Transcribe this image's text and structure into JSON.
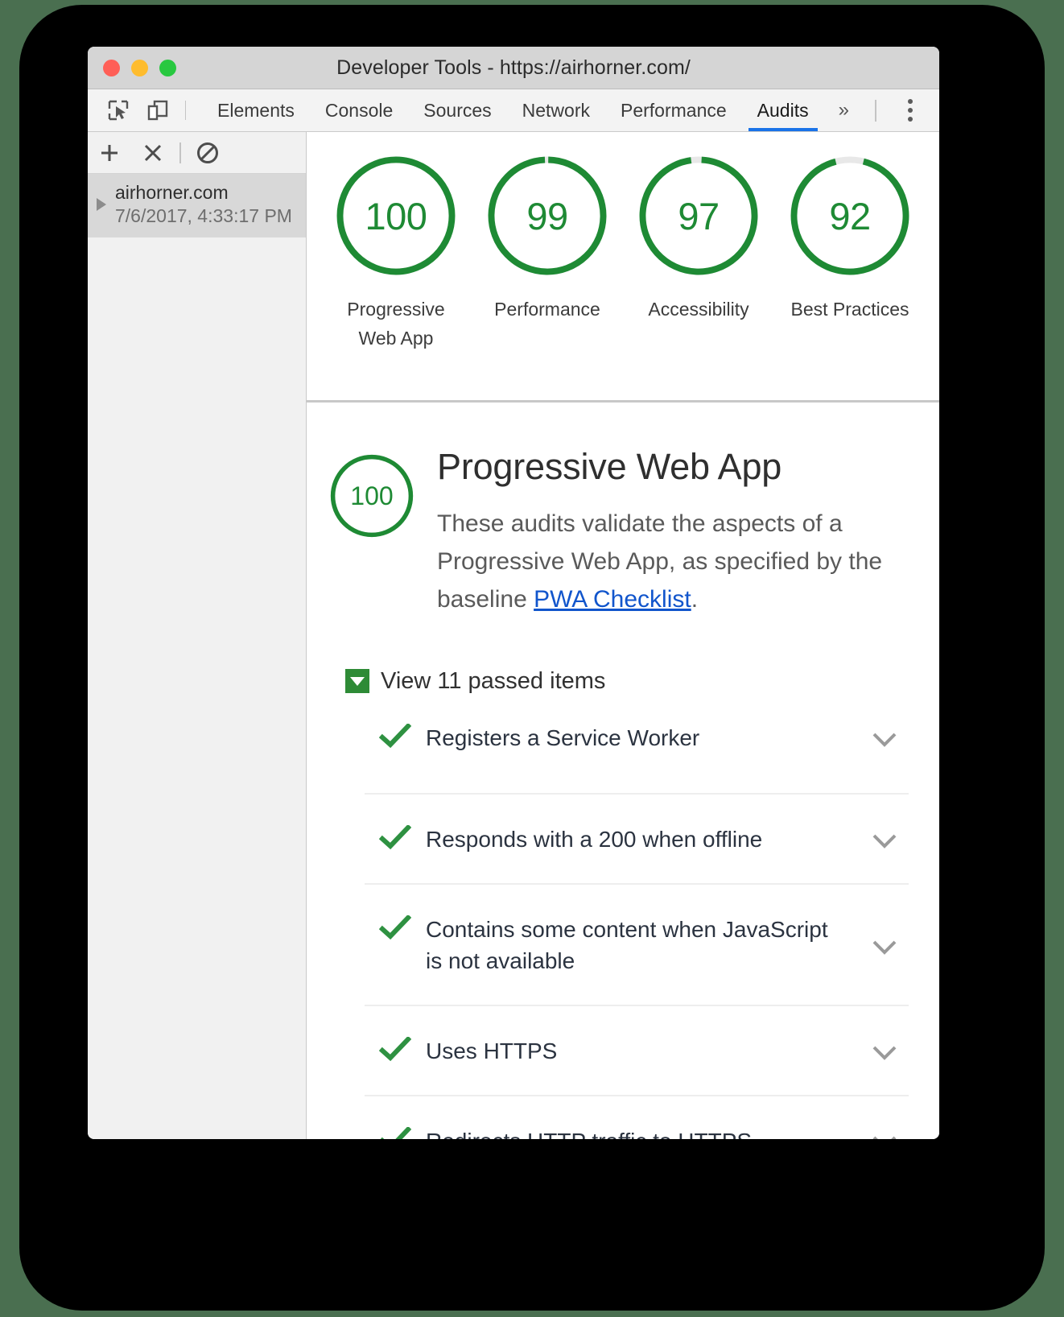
{
  "window": {
    "title": "Developer Tools - https://airhorner.com/",
    "traffic_lights": [
      "close-button",
      "minimize-button",
      "zoom-button"
    ]
  },
  "tabbar": {
    "inspect_icon": "inspect-element-icon",
    "device_icon": "device-toolbar-icon",
    "overflow_label": "»",
    "tabs": [
      {
        "label": "Elements",
        "active": false
      },
      {
        "label": "Console",
        "active": false
      },
      {
        "label": "Sources",
        "active": false
      },
      {
        "label": "Network",
        "active": false
      },
      {
        "label": "Performance",
        "active": false
      },
      {
        "label": "Audits",
        "active": true
      }
    ],
    "menu_icon": "more-options-kebab-icon"
  },
  "sidebar": {
    "toolbar": {
      "add_icon": "plus-icon",
      "clear_icon": "close-x-icon",
      "block_icon": "no-entry-icon"
    },
    "report": {
      "host": "airhorner.com",
      "timestamp": "7/6/2017, 4:33:17 PM",
      "expander_icon": "triangle-right-icon"
    }
  },
  "scores": [
    {
      "value": "100",
      "score": 100,
      "label": "Progressive Web App"
    },
    {
      "value": "99",
      "score": 99,
      "label": "Performance"
    },
    {
      "value": "97",
      "score": 97,
      "label": "Accessibility"
    },
    {
      "value": "92",
      "score": 92,
      "label": "Best Practices"
    }
  ],
  "category": {
    "score_value": "100",
    "score": 100,
    "title": "Progressive Web App",
    "description_before": "These audits validate the aspects of a Progressive Web App, as specified by the baseline ",
    "link_text": "PWA Checklist",
    "description_after": "."
  },
  "passed": {
    "toggle_label": "View 11 passed items",
    "count": 11,
    "caret_icon": "caret-down-icon",
    "items": [
      {
        "title": "Registers a Service Worker",
        "status_icon": "check-icon",
        "expand_icon": "chevron-down-icon"
      },
      {
        "title": "Responds with a 200 when offline",
        "status_icon": "check-icon",
        "expand_icon": "chevron-down-icon"
      },
      {
        "title": "Contains some content when JavaScript is not available",
        "status_icon": "check-icon",
        "expand_icon": "chevron-down-icon"
      },
      {
        "title": "Uses HTTPS",
        "status_icon": "check-icon",
        "expand_icon": "chevron-down-icon"
      },
      {
        "title": "Redirects HTTP traffic to HTTPS",
        "status_icon": "check-icon",
        "expand_icon": "chevron-down-icon"
      }
    ]
  },
  "colors": {
    "pass_green": "#1e8a34",
    "gauge_track": "#e8e8e8",
    "link_blue": "#1155cc",
    "tab_active_underline": "#1a73e8",
    "page_background": "#4a6f50"
  }
}
